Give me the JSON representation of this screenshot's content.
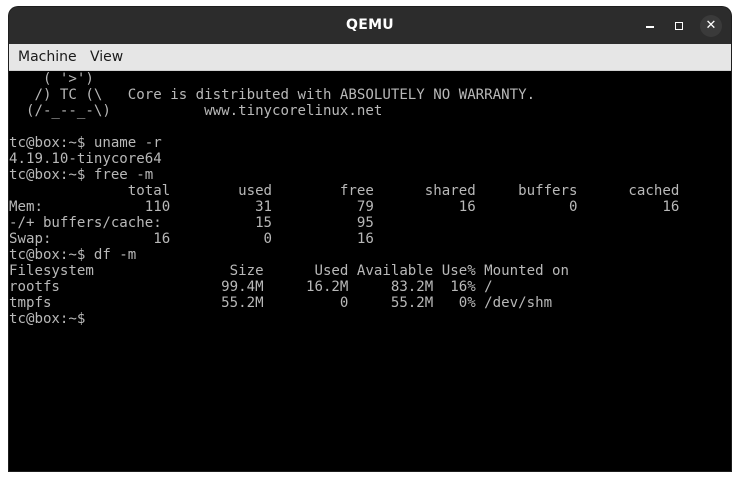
{
  "window": {
    "title": "QEMU",
    "controls": {
      "minimize": "",
      "maximize": "",
      "close": "✕"
    }
  },
  "menubar": {
    "items": [
      "Machine",
      "View"
    ]
  },
  "terminal": {
    "lines": [
      "    ( '>')",
      "   /) TC (\\   Core is distributed with ABSOLUTELY NO WARRANTY.",
      "  (/-_--_-\\)           www.tinycorelinux.net",
      "",
      "tc@box:~$ uname -r",
      "4.19.10-tinycore64",
      "tc@box:~$ free -m",
      "              total        used        free      shared     buffers      cached",
      "Mem:            110          31          79          16           0          16",
      "-/+ buffers/cache:           15          95",
      "Swap:            16           0          16",
      "tc@box:~$ df -m",
      "Filesystem                Size      Used Available Use% Mounted on",
      "rootfs                   99.4M     16.2M     83.2M  16% /",
      "tmpfs                    55.2M         0     55.2M   0% /dev/shm",
      "tc@box:~$"
    ]
  }
}
